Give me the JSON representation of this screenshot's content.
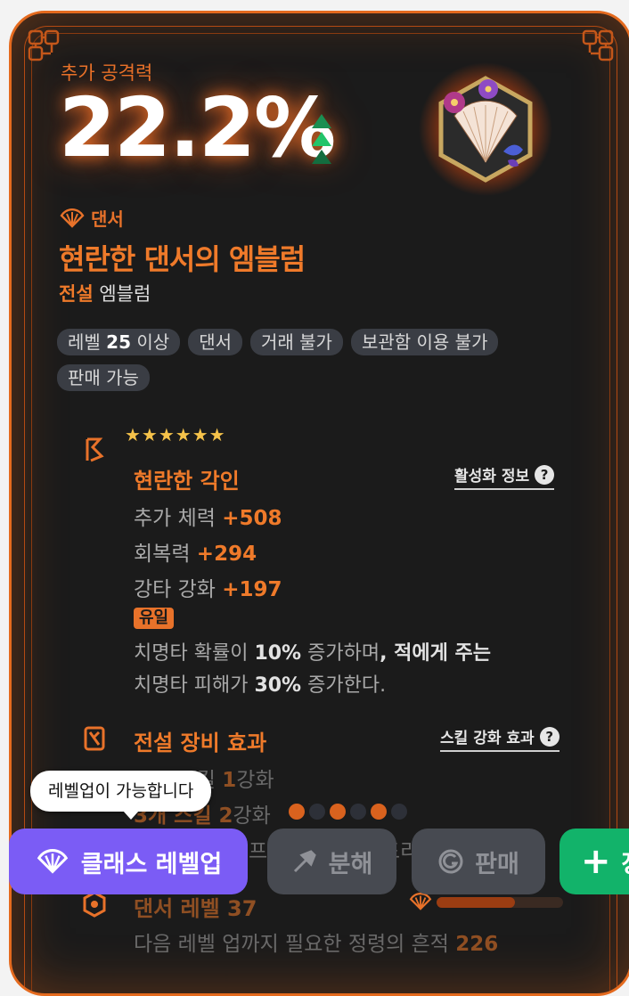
{
  "stat": {
    "label": "추가 공격력",
    "value": "22.2%"
  },
  "item": {
    "class_name": "댄서",
    "name": "현란한 댄서의 엠블럼",
    "grade": "전설",
    "type": "엠블럼"
  },
  "tags": [
    {
      "pre": "레벨 ",
      "bold": "25",
      "post": " 이상"
    },
    {
      "pre": "댄서",
      "bold": "",
      "post": ""
    },
    {
      "pre": "거래 불가",
      "bold": "",
      "post": ""
    },
    {
      "pre": "보관함 이용 불가",
      "bold": "",
      "post": ""
    },
    {
      "pre": "판매 가능",
      "bold": "",
      "post": ""
    }
  ],
  "engraving": {
    "stars": "★★★★★★",
    "title": "현란한 각인",
    "info_link": "활성화 정보",
    "stats": [
      {
        "name": "추가 체력 ",
        "value": "+508"
      },
      {
        "name": "회복력 ",
        "value": "+294"
      },
      {
        "name": "강타 강화 ",
        "value": "+197"
      }
    ],
    "unique_badge": "유일",
    "desc_1a": "치명타 확률이 ",
    "desc_1b": "10%",
    "desc_1c": " 증가하며",
    "desc_1d": ", 적에게 주는",
    "desc_2a": "치명타 피해가 ",
    "desc_2b": "30%",
    "desc_2c": " 증가한다."
  },
  "legendary": {
    "title": "전설 장비 효과",
    "info_link": "스킬 강화 효과",
    "line1_pre": "모든 스킬 ",
    "line1_val": "1",
    "line1_post": "강화",
    "line2_pre": "3개 스킬 ",
    "line2_val": "2",
    "line2_post": "강화",
    "line3": "프론트 스텝, 애드리브",
    "dot_colors": [
      "#d9621e",
      "#2d3038",
      "#d9621e",
      "#2d3038",
      "#d9621e",
      "#2d3038"
    ]
  },
  "class_level": {
    "title": "댄서 레벨 37",
    "next_pre": "다음 레벨 업까지 필요한 정령의 흔적 ",
    "next_val": "226",
    "progress": 0.62
  },
  "tooltip": "레벨업이 가능합니다",
  "buttons": {
    "class_levelup": "클래스 레벨업",
    "disassemble": "분해",
    "sell": "판매",
    "green": "장"
  }
}
